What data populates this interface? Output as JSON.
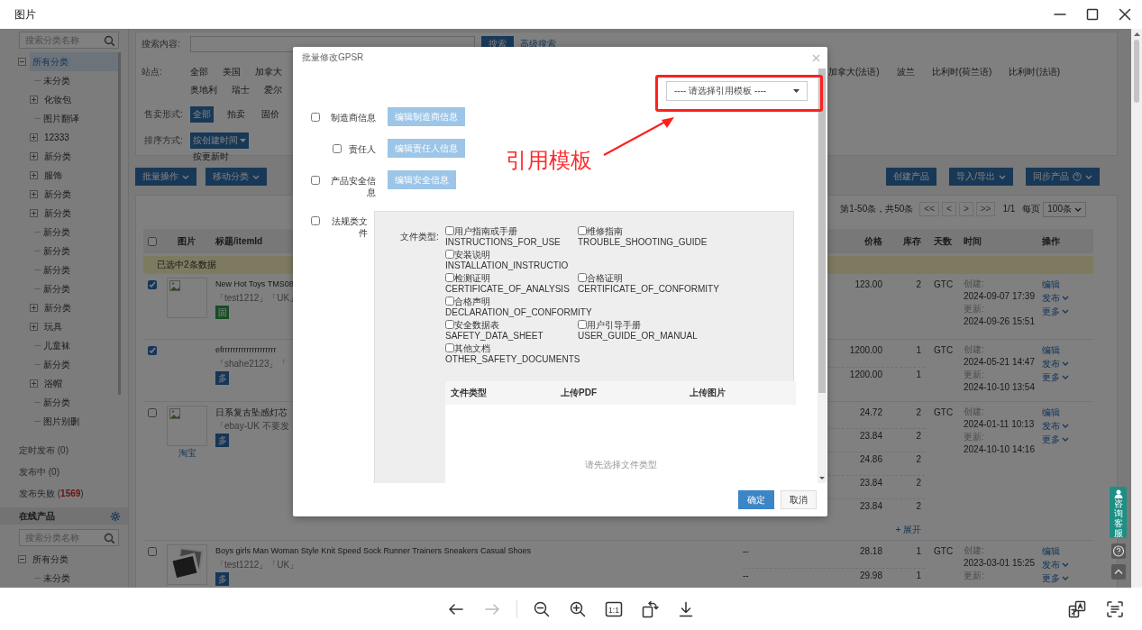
{
  "window": {
    "title": "图片"
  },
  "viewer": {
    "back_disabled": false,
    "forward_disabled": true,
    "actual_size_label": "1:1"
  },
  "sidebar": {
    "search_placeholder": "搜索分类名称",
    "tree": [
      {
        "label": "所有分类",
        "expanded": true,
        "selected": true,
        "children": [
          {
            "label": "未分类",
            "selected": false
          },
          {
            "label": "化妆包",
            "expanded": false,
            "selected": false
          },
          {
            "label": "图片翻译",
            "selected": false
          },
          {
            "label": "12333",
            "expanded": false,
            "selected": false
          },
          {
            "label": "新分类",
            "expanded": false,
            "selected": false
          },
          {
            "label": "服饰",
            "expanded": false,
            "selected": false
          },
          {
            "label": "新分类",
            "expanded": false,
            "selected": false
          },
          {
            "label": "新分类",
            "expanded": false,
            "selected": false
          },
          {
            "label": "新分类",
            "selected": false
          },
          {
            "label": "新分类",
            "selected": false
          },
          {
            "label": "新分类",
            "selected": false
          },
          {
            "label": "新分类",
            "selected": false
          },
          {
            "label": "新分类",
            "expanded": false,
            "selected": false
          },
          {
            "label": "玩具",
            "expanded": false,
            "selected": false
          },
          {
            "label": "儿童袜",
            "selected": false
          },
          {
            "label": "新分类",
            "selected": false
          },
          {
            "label": "浴帽",
            "expanded": false,
            "selected": false
          },
          {
            "label": "新分类",
            "selected": false
          },
          {
            "label": "图片别删",
            "selected": false
          }
        ]
      }
    ],
    "statuses": [
      {
        "label": "定时发布 (0)"
      },
      {
        "label": "发布中 (0)"
      },
      {
        "label": "发布失败 (",
        "count": "1569",
        "label_end": ")"
      }
    ],
    "online": {
      "title": "在线产品",
      "search_placeholder": "搜索分类名称",
      "tree": [
        {
          "label": "所有分类",
          "expanded": true,
          "selected": false,
          "children": [
            {
              "label": "未分类",
              "selected": false
            }
          ]
        }
      ]
    }
  },
  "filters": {
    "search_label": "搜索内容:",
    "search_button": "搜索",
    "advanced_link": "高级搜索",
    "site_label": "站点:",
    "site_rows": [
      [
        "全部",
        "美国",
        "加拿大"
      ],
      [
        "奥地利",
        "瑞士",
        "爱尔"
      ]
    ],
    "site_more": [
      "加拿大(法语)",
      "波兰",
      "比利时(荷兰语)",
      "比利时(法语)"
    ],
    "sale_label": "售卖形式:",
    "sale_options": [
      {
        "label": "全部",
        "selected": true
      },
      {
        "label": "拍卖",
        "selected": false
      },
      {
        "label": "固价",
        "selected": false
      }
    ],
    "sort_label": "排序方式:",
    "sort_options": [
      {
        "label": "按创建时间",
        "selected": true
      },
      {
        "label": "按更新时",
        "selected": false
      }
    ]
  },
  "toolbar": {
    "left": [
      {
        "label": "批量操作",
        "kind": "dropdown"
      },
      {
        "label": "移动分类",
        "kind": "dropdown"
      }
    ],
    "right": [
      {
        "label": "创建产品",
        "kind": "plain"
      },
      {
        "label": "导入/导出",
        "kind": "dropdown"
      },
      {
        "label": "同步产品",
        "kind": "help_dropdown"
      }
    ]
  },
  "pagination": {
    "summary": "第1-50条，共50条",
    "buttons": [
      "<<",
      "<",
      ">",
      ">>"
    ],
    "page": "1/1",
    "per_page_label": "每页",
    "per_page": "100条"
  },
  "table": {
    "select_all_checked": false,
    "columns": [
      "图片",
      "标题/itemId",
      "价格",
      "库存",
      "天数",
      "时间",
      "操作"
    ],
    "selection_note": "已选中2条数据",
    "rows": [
      {
        "checked": true,
        "image": {
          "kind": "broken"
        },
        "title": "New Hot Toys TMS08",
        "tags": "「test1212」「UK」",
        "badge": {
          "text": "固",
          "kind": "fixed"
        },
        "variants": [
          {
            "price": "123.00",
            "stock": "2"
          }
        ],
        "duration": "GTC",
        "created_label": "创建:",
        "created": "2024-09-07 17:39",
        "updated_label": "更新:",
        "updated": "2024-09-26 15:51",
        "actions": [
          {
            "label": "编辑",
            "menu": false
          },
          {
            "label": "发布",
            "menu": true
          },
          {
            "label": "更多",
            "menu": true
          }
        ]
      },
      {
        "checked": true,
        "title": "efrrrrrrrrrrrrrrrrrrrr",
        "tags": "「shahe2123」「",
        "badge": {
          "text": "多",
          "kind": "multi"
        },
        "variants": [
          {
            "price": "1200.00",
            "stock": "1"
          },
          {
            "price": "1200.00",
            "stock": "1"
          }
        ],
        "duration": "GTC",
        "created_label": "创建:",
        "created": "2024-05-21 14:47",
        "updated_label": "更新:",
        "updated": "2024-10-10 13:54",
        "actions": [
          {
            "label": "编辑",
            "menu": false
          },
          {
            "label": "发布",
            "menu": true
          },
          {
            "label": "更多",
            "menu": true
          }
        ]
      },
      {
        "checked": false,
        "image": {
          "kind": "broken"
        },
        "source": "淘宝",
        "title": "日系复古坠感灯芯",
        "tags": "「ebay-UK 不要发",
        "badge": {
          "text": "多",
          "kind": "multi"
        },
        "variants": [
          {
            "price": "24.72",
            "stock": "2"
          },
          {
            "price": "23.84",
            "stock": "2"
          },
          {
            "price": "24.86",
            "stock": "2"
          },
          {
            "price": "23.84",
            "stock": "2"
          },
          {
            "price": "23.84",
            "stock": "2"
          }
        ],
        "expand": "+ 展开",
        "duration": "GTC",
        "created_label": "创建:",
        "created": "2024-01-11 10:13",
        "updated_label": "更新:",
        "updated": "2024-10-10 14:16",
        "actions": [
          {
            "label": "编辑",
            "menu": false
          },
          {
            "label": "发布",
            "menu": true
          },
          {
            "label": "更多",
            "menu": true
          }
        ]
      },
      {
        "checked": false,
        "image": {
          "kind": "photo"
        },
        "title": "Boys girls Man Woman Style Knit Speed Sock Runner Trainers Sneakers Casual Shoes",
        "tags": "「test1212」「UK」",
        "badge": {
          "text": "多",
          "kind": "multi"
        },
        "variants": [
          {
            "sku": "--",
            "price": "28.18",
            "stock": "1"
          },
          {
            "sku": "--",
            "price": "29.98",
            "stock": "1"
          }
        ],
        "duration": "GTC",
        "created_label": "创建:",
        "created": "2023-03-01 15:25",
        "updated_label": "更新:",
        "actions": [
          {
            "label": "编辑",
            "menu": false
          },
          {
            "label": "发布",
            "menu": true
          },
          {
            "label": "更多",
            "menu": true
          }
        ]
      }
    ]
  },
  "support": {
    "label": "咨询客服"
  },
  "modal": {
    "title": "批量修改GPSR",
    "template_placeholder": "---- 请选择引用模板 ----",
    "sections": [
      {
        "label": "制造商信息",
        "checked": false,
        "button": "编辑制造商信息",
        "disabled": true,
        "children": [
          {
            "label": "责任人",
            "checked": false,
            "button": "编辑责任人信息",
            "disabled": true
          }
        ]
      },
      {
        "label": "产品安全信息",
        "checked": false,
        "button": "编辑安全信息",
        "disabled": true
      },
      {
        "label": "法规类文件",
        "checked": false,
        "kind": "documents"
      }
    ],
    "documents": {
      "label": "文件类型:",
      "rows": [
        {
          "items": [
            {
              "name": "用户指南或手册",
              "code": "INSTRUCTIONS_FOR_USE",
              "checked": false
            },
            {
              "name": "维修指南",
              "code": "TROUBLE_SHOOTING_GUIDE",
              "checked": false
            }
          ]
        },
        {
          "items": [
            {
              "name": "安装说明",
              "code": "INSTALLATION_INSTRUCTIO",
              "checked": false
            }
          ]
        },
        {
          "items": [
            {
              "name": "检测证明",
              "code": "CERTIFICATE_OF_ANALYSIS",
              "checked": false
            },
            {
              "name": "合格证明",
              "code": "CERTIFICATE_OF_CONFORMITY",
              "checked": false
            }
          ]
        },
        {
          "items": [
            {
              "name": "合格声明",
              "code": "DECLARATION_OF_CONFORMITY",
              "checked": false
            }
          ]
        },
        {
          "items": [
            {
              "name": "安全数据表",
              "code": "SAFETY_DATA_SHEET",
              "checked": false
            },
            {
              "name": "用户引导手册",
              "code": "USER_GUIDE_OR_MANUAL",
              "checked": false
            }
          ]
        },
        {
          "items": [
            {
              "name": "其他文档",
              "code": "OTHER_SAFETY_DOCUMENTS",
              "checked": false
            }
          ]
        }
      ],
      "columns": [
        "文件类型",
        "上传PDF",
        "上传图片"
      ],
      "empty": "请先选择文件类型"
    },
    "buttons": [
      {
        "label": "确定",
        "kind": "primary"
      },
      {
        "label": "取消",
        "kind": "secondary"
      }
    ]
  },
  "annotation": {
    "text": "引用模板"
  }
}
